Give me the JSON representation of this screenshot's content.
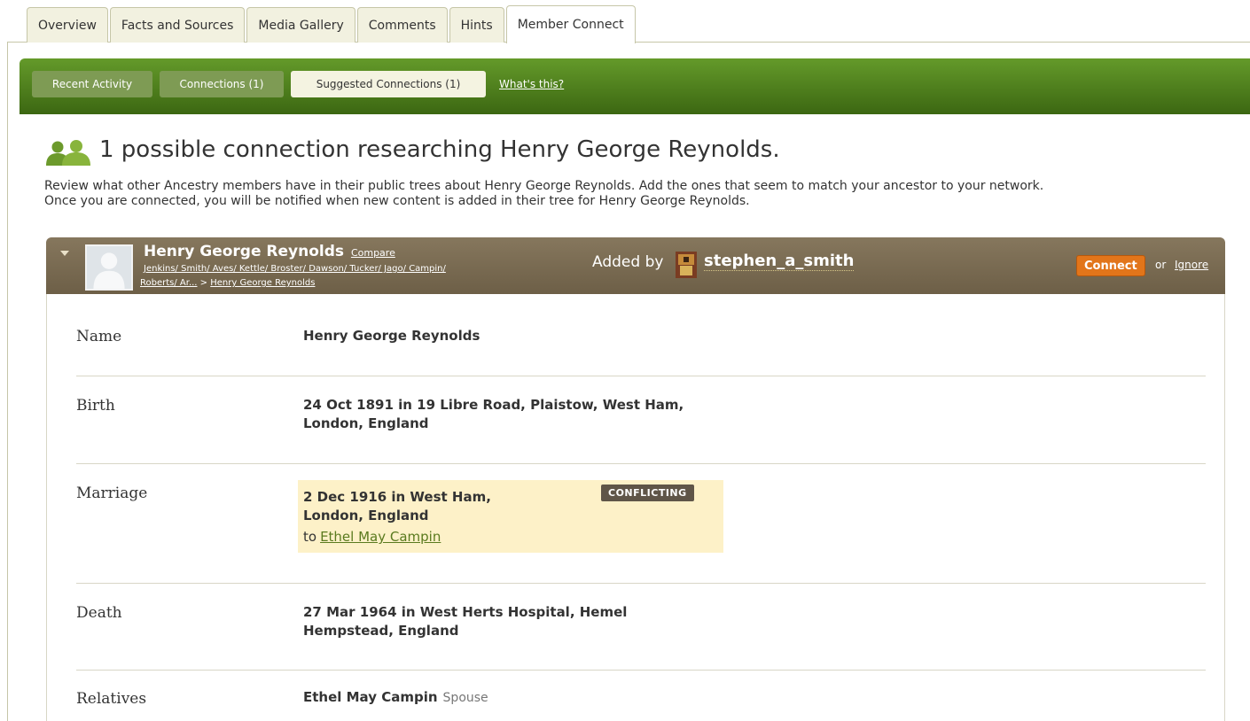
{
  "top_tabs": [
    "Overview",
    "Facts and Sources",
    "Media Gallery",
    "Comments",
    "Hints",
    "Member Connect"
  ],
  "active_top_tab": "Member Connect",
  "sub_tabs": {
    "recent": "Recent Activity",
    "connections": "Connections (1)",
    "suggested": "Suggested Connections (1)",
    "whats_this": "What's this?"
  },
  "heading": "1 possible connection researching Henry George Reynolds.",
  "intro_line1": "Review what other Ancestry members have in their public trees about Henry George Reynolds. Add the ones that seem to match your ancestor to your network.",
  "intro_line2": "Once you are connected, you will be notified when new content is added in their tree for Henry George Reynolds.",
  "connection": {
    "name": "Henry George Reynolds",
    "compare": "Compare",
    "path_line1": "Jenkins/ Smith/ Aves/ Kettle/ Broster/ Dawson/ Tucker/ Jago/ Campin/",
    "path_line2_tree": "Roberts/ Ar...",
    "path_sep": ">",
    "path_person": "Henry George Reynolds",
    "added_by_label": "Added by",
    "username": "stephen_a_smith",
    "connect_label": "Connect",
    "or_text": "or",
    "ignore_label": "Ignore"
  },
  "facts": {
    "name_label": "Name",
    "name_value": "Henry George Reynolds",
    "birth_label": "Birth",
    "birth_line1": "24 Oct 1891 in 19 Libre Road, Plaistow, West Ham,",
    "birth_line2": "London, England",
    "marriage_label": "Marriage",
    "marriage_line1": "2 Dec 1916 in West Ham,",
    "marriage_line2": "London, England",
    "marriage_to": "to",
    "marriage_spouse": "Ethel May Campin",
    "conflict_badge": "CONFLICTING",
    "death_label": "Death",
    "death_line1": "27 Mar 1964 in West Herts Hospital, Hemel",
    "death_line2": "Hempstead, England",
    "relatives_label": "Relatives",
    "relative_name": "Ethel May Campin",
    "relative_type": "Spouse"
  },
  "colors": {
    "green_bar": "#4f7f1c",
    "panel_header": "#7a6b52",
    "connect": "#e2751a",
    "conflict_bg": "#fdf1c8",
    "badge": "#5f5548"
  }
}
